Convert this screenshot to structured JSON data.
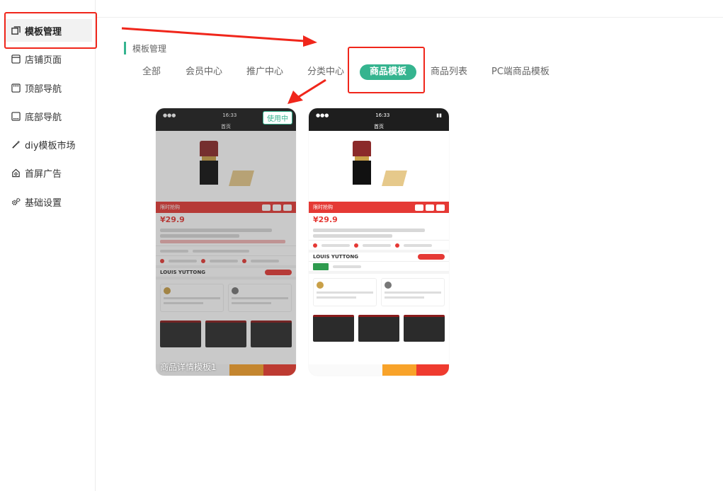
{
  "sidebar": {
    "items": [
      {
        "label": "模板管理",
        "icon": "template-icon",
        "active": true
      },
      {
        "label": "店铺页面",
        "icon": "page-icon",
        "active": false
      },
      {
        "label": "顶部导航",
        "icon": "top-nav-icon",
        "active": false
      },
      {
        "label": "底部导航",
        "icon": "bottom-nav-icon",
        "active": false
      },
      {
        "label": "diy模板市场",
        "icon": "magic-wand-icon",
        "active": false
      },
      {
        "label": "首屏广告",
        "icon": "ad-icon",
        "active": false
      },
      {
        "label": "基础设置",
        "icon": "gear-icon",
        "active": false
      }
    ]
  },
  "breadcrumb": {
    "title": "模板管理"
  },
  "tabs": [
    {
      "label": "全部"
    },
    {
      "label": "会员中心"
    },
    {
      "label": "推广中心"
    },
    {
      "label": "分类中心"
    },
    {
      "label": "商品模板",
      "active": true
    },
    {
      "label": "商品列表"
    },
    {
      "label": "PC端商品模板"
    }
  ],
  "cards": [
    {
      "name": "商品详情模板1",
      "badge": "使用中",
      "price": "¥29.9",
      "brand": "LOUIS YUTTONG"
    },
    {
      "name": "",
      "badge": "",
      "price": "¥29.9",
      "brand": "LOUIS YUTTONG"
    }
  ],
  "colors": {
    "accent": "#35b48f",
    "annotation": "#f0261b",
    "price": "#e53935"
  }
}
